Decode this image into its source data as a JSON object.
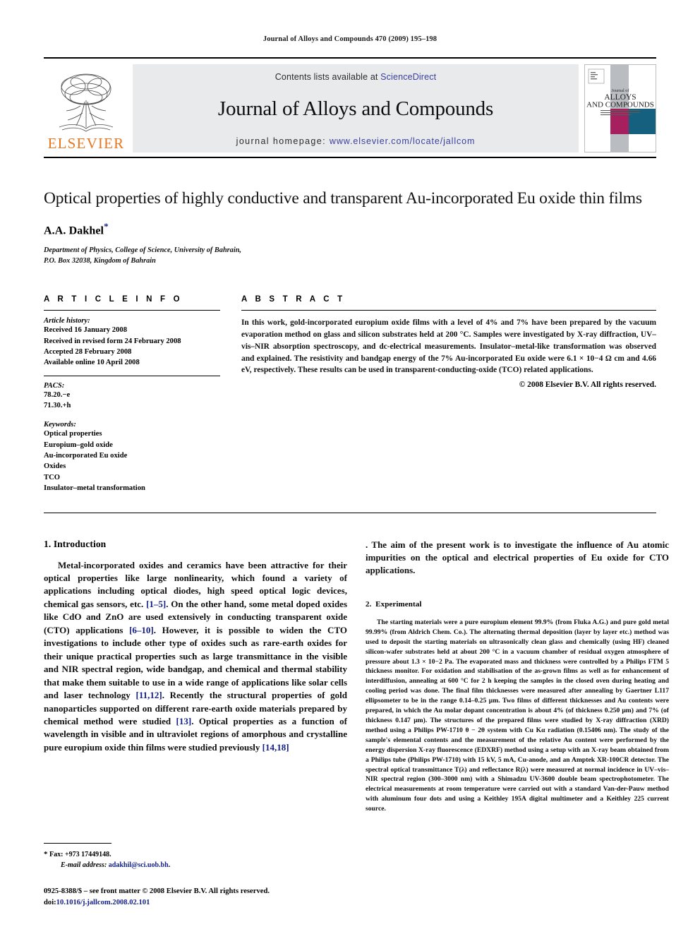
{
  "running_head": "Journal of Alloys and Compounds 470 (2009) 195–198",
  "masthead": {
    "publisher_wordmark": "ELSEVIER",
    "contents_prefix": "Contents lists available at ",
    "sciencedirect": "ScienceDirect",
    "journal_name": "Journal of Alloys and Compounds",
    "homepage_prefix": "journal homepage: ",
    "homepage_url": "www.elsevier.com/locate/jallcom",
    "cover": {
      "line1": "Journal of",
      "line2": "ALLOYS",
      "line3": "AND COMPOUNDS"
    },
    "link_color": "#3b3f9c",
    "elsevier_orange": "#E87722"
  },
  "title": "Optical properties of highly conductive and transparent Au-incorporated Eu oxide thin films",
  "authors": "A.A. Dakhel",
  "author_marker": "*",
  "affiliation_lines": [
    "Department of Physics, College of Science, University of Bahrain,",
    "P.O. Box 32038, Kingdom of Bahrain"
  ],
  "article_info": {
    "heading": "A R T I C L E    I N F O",
    "history_label": "Article history:",
    "history": [
      "Received 16 January 2008",
      "Received in revised form 24 February 2008",
      "Accepted 28 February 2008",
      "Available online 10 April 2008"
    ],
    "pacs_label": "PACS:",
    "pacs": [
      "78.20.−e",
      "71.30.+h"
    ],
    "keywords_label": "Keywords:",
    "keywords": [
      "Optical properties",
      "Europium–gold oxide",
      "Au-incorporated Eu oxide",
      "Oxides",
      "TCO",
      "Insulator–metal transformation"
    ]
  },
  "abstract": {
    "heading": "A B S T R A C T",
    "body": "In this work, gold-incorporated europium oxide films with a level of 4% and 7% have been prepared by the vacuum evaporation method on glass and silicon substrates held at 200 °C. Samples were investigated by X-ray diffraction, UV–vis–NIR absorption spectroscopy, and dc-electrical measurements. Insulator–metal-like transformation was observed and explained. The resistivity and bandgap energy of the 7% Au-incorporated Eu oxide were 6.1 × 10−4 Ω cm and 4.66 eV, respectively. These results can be used in transparent-conducting-oxide (TCO) related applications.",
    "copyright": "© 2008 Elsevier B.V. All rights reserved."
  },
  "sections": {
    "introduction": {
      "number": "1.",
      "title": "Introduction",
      "paragraph_part1": "Metal-incorporated oxides and ceramics have been attractive for their optical properties like large nonlinearity, which found a variety of applications including optical diodes, high speed optical logic devices, chemical gas sensors, etc. ",
      "ref1": "[1–5]",
      "paragraph_part2": ". On the other hand, some metal doped oxides like CdO and ZnO are used extensively in conducting transparent oxide (CTO) applications ",
      "ref2": "[6–10]",
      "paragraph_part3": ". However, it is possible to widen the CTO investigations to include other type of oxides such as rare-earth oxides for their unique practical properties such as large transmittance in the visible and NIR spectral region, wide bandgap, and chemical and thermal stability that make them suitable to use in a wide range of applications like solar cells and laser technology ",
      "ref3": "[11,12]",
      "paragraph_part4": ". Recently the structural properties of gold nanoparticles supported on different rare-earth oxide materials prepared by chemical method were studied ",
      "ref4": "[13]",
      "paragraph_part5": ". Optical properties as a function of wavelength in visible and in ultraviolet regions of amorphous and crystalline pure europium oxide thin films were studied previously ",
      "ref5": "[14,18]",
      "paragraph_part6": ". The aim of the present work is to investigate the influence of Au atomic impurities on the optical and electrical properties of Eu oxide for CTO applications."
    },
    "experimental": {
      "number": "2.",
      "title": "Experimental",
      "paragraph": "The starting materials were a pure europium element 99.9% (from Fluka A.G.) and pure gold metal 99.99% (from Aldrich Chem. Co.). The alternating thermal deposition (layer by layer etc.) method was used to deposit the starting materials on ultrasonically clean glass and chemically (using HF) cleaned silicon-wafer substrates held at about 200 °C in a vacuum chamber of residual oxygen atmosphere of pressure about 1.3 × 10−2 Pa. The evaporated mass and thickness were controlled by a Philips FTM 5 thickness monitor. For oxidation and stabilisation of the as-grown films as well as for enhancement of interdiffusion, annealing at 600 °C for 2 h keeping the samples in the closed oven during heating and cooling period was done. The final film thicknesses were measured after annealing by Gaertner L117 ellipsometer to be in the range 0.14–0.25 μm. Two films of different thicknesses and Au contents were prepared, in which the Au molar dopant concentration is about 4% (of thickness 0.250 μm) and 7% (of thickness 0.147 μm). The structures of the prepared films were studied by X-ray diffraction (XRD) method using a Philips PW-1710 θ − 2θ system with Cu Kα radiation (0.15406 nm). The study of the sample's elemental contents and the measurement of the relative Au content were performed by the energy dispersion X-ray fluorescence (EDXRF) method using a setup with an X-ray beam obtained from a Philips tube (Philips PW-1710) with 15 kV, 5 mA, Cu-anode, and an Amptek XR-100CR detector. The spectral optical transmittance T(λ) and reflectance R(λ) were measured at normal incidence in UV–vis–NIR spectral region (300–3000 nm) with a Shimadzu UV-3600 double beam spectrophotometer. The electrical measurements at room temperature were carried out with a standard Van-der-Pauw method with aluminum four dots and using a Keithley 195A digital multimeter and a Keithley 225 current source."
    }
  },
  "footnotes": {
    "fax_marker": "*",
    "fax": "Fax: +973 17449148.",
    "email_label": "E-mail address:",
    "email": "adakhil@sci.uob.bh",
    "email_suffix": ".",
    "issn_line": "0925-8388/$ – see front matter © 2008 Elsevier B.V. All rights reserved.",
    "doi_label": "doi:",
    "doi": "10.1016/j.jallcom.2008.02.101"
  }
}
